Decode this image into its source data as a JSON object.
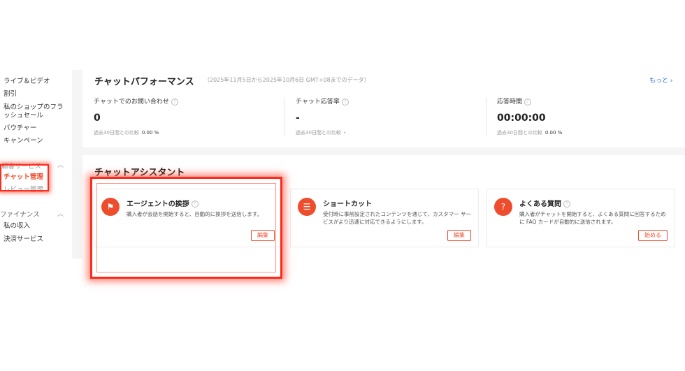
{
  "sidebar": {
    "items": [
      {
        "label": "ライブ＆ビデオ"
      },
      {
        "label": "割引"
      },
      {
        "label": "私のショップのフラッシュセール"
      },
      {
        "label": "バウチャー"
      },
      {
        "label": "キャンペーン"
      }
    ],
    "customer_service_group": {
      "label": "顧客サービス",
      "items": [
        {
          "label": "チャット管理",
          "active": true
        },
        {
          "label": "レビュー管理"
        }
      ]
    },
    "finance_group": {
      "label": "ファイナンス",
      "items": [
        {
          "label": "私の収入"
        },
        {
          "label": "決済サービス"
        }
      ]
    }
  },
  "performance": {
    "title": "チャットパフォーマンス",
    "date_range": "（2025年11月5日から2025年10月6日 GMT+08までのデータ）",
    "more_link": "もっと",
    "metrics": [
      {
        "label": "チャットでのお問い合わせ",
        "value": "0",
        "comparison_label": "過去30日間との比較",
        "comparison_value": "0.00 %"
      },
      {
        "label": "チャット応答率",
        "value": "-",
        "comparison_label": "過去30日間との比較",
        "comparison_value": "-"
      },
      {
        "label": "応答時間",
        "value": "00:00:00",
        "comparison_label": "過去30日間との比較",
        "comparison_value": "0.00 %"
      }
    ]
  },
  "assistant": {
    "title": "チャットアシスタント",
    "features": [
      {
        "name": "エージェントの挨拶",
        "description": "購入者が会話を開始すると、自動的に挨拶を送信します。",
        "button": "編集",
        "icon": "greeting-icon"
      },
      {
        "name": "ショートカット",
        "description": "受付時に事前設定されたコンテンツを通じて、カスタマー サービスがより迅速に対応できるようにします。",
        "button": "編集",
        "icon": "shortcut-icon"
      },
      {
        "name": "よくある質問",
        "description": "購入者がチャットを開始すると、よくある質問に回答するために FAQ カードが自動的に送信されます。",
        "button": "始める",
        "icon": "faq-icon"
      }
    ]
  },
  "colors": {
    "accent": "#ee4d2d",
    "link": "#2673dd",
    "highlight": "#ff2a1a"
  }
}
